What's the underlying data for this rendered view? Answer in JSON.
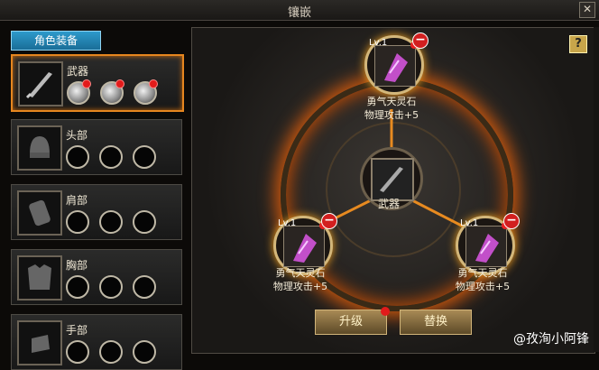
{
  "window": {
    "title": "镶嵌",
    "close": "✕"
  },
  "tabs": {
    "active": "角色装备"
  },
  "slots": [
    {
      "name": "武器",
      "gems": [
        true,
        true,
        true
      ],
      "active": true
    },
    {
      "name": "头部",
      "gems": [
        false,
        false,
        false
      ]
    },
    {
      "name": "肩部",
      "gems": [
        false,
        false,
        false
      ]
    },
    {
      "name": "胸部",
      "gems": [
        false,
        false,
        false
      ]
    },
    {
      "name": "手部",
      "gems": [
        false,
        false,
        false
      ]
    }
  ],
  "inlay": {
    "center_label": "武器",
    "gems": [
      {
        "level": "Lv.1",
        "name": "勇气天灵石",
        "effect": "物理攻击+5"
      },
      {
        "level": "Lv.1",
        "name": "勇气天灵石",
        "effect": "物理攻击+5"
      },
      {
        "level": "Lv.1",
        "name": "勇气天灵石",
        "effect": "物理攻击+5"
      }
    ]
  },
  "buttons": {
    "upgrade": "升级",
    "replace": "替换",
    "help": "?"
  },
  "watermark": "@孜洵小阿锋"
}
